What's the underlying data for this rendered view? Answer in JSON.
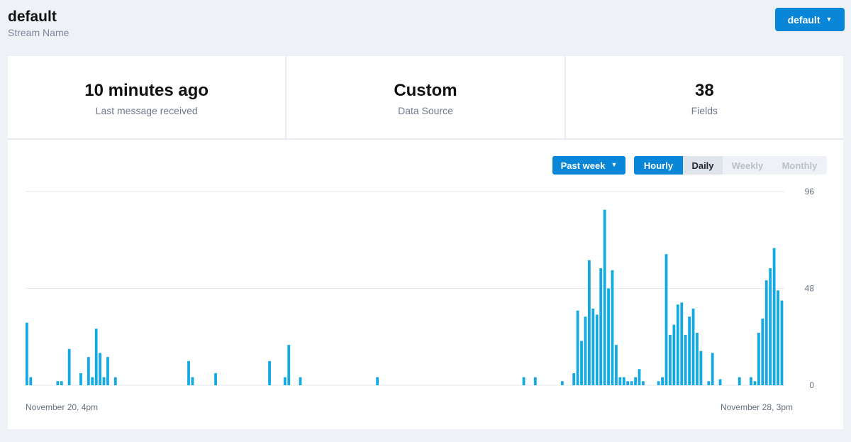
{
  "stream": {
    "title": "default",
    "subtitle": "Stream Name",
    "selector_label": "default"
  },
  "stats": [
    {
      "value": "10 minutes ago",
      "label": "Last message received"
    },
    {
      "value": "Custom",
      "label": "Data Source"
    },
    {
      "value": "38",
      "label": "Fields"
    }
  ],
  "controls": {
    "range_label": "Past week",
    "granularity": [
      "Hourly",
      "Daily",
      "Weekly",
      "Monthly"
    ],
    "granularity_active": "Hourly"
  },
  "icons": {
    "dropdown": "chevron-down-icon"
  },
  "colors": {
    "accent": "#0a86d8",
    "bar": "#13aae3"
  },
  "chart_data": {
    "type": "bar",
    "x_start_label": "November 20, 4pm",
    "x_end_label": "November 28, 3pm",
    "y_ticks": [
      0,
      48,
      96
    ],
    "ylim": [
      0,
      96
    ],
    "grid": true,
    "values": [
      31,
      4,
      0,
      0,
      0,
      0,
      0,
      0,
      2,
      2,
      0,
      18,
      0,
      0,
      6,
      0,
      14,
      4,
      28,
      16,
      4,
      14,
      0,
      4,
      0,
      0,
      0,
      0,
      0,
      0,
      0,
      0,
      0,
      0,
      0,
      0,
      0,
      0,
      0,
      0,
      0,
      0,
      12,
      4,
      0,
      0,
      0,
      0,
      0,
      6,
      0,
      0,
      0,
      0,
      0,
      0,
      0,
      0,
      0,
      0,
      0,
      0,
      0,
      12,
      0,
      0,
      0,
      4,
      20,
      0,
      0,
      4,
      0,
      0,
      0,
      0,
      0,
      0,
      0,
      0,
      0,
      0,
      0,
      0,
      0,
      0,
      0,
      0,
      0,
      0,
      0,
      4,
      0,
      0,
      0,
      0,
      0,
      0,
      0,
      0,
      0,
      0,
      0,
      0,
      0,
      0,
      0,
      0,
      0,
      0,
      0,
      0,
      0,
      0,
      0,
      0,
      0,
      0,
      0,
      0,
      0,
      0,
      0,
      0,
      0,
      0,
      0,
      0,
      0,
      4,
      0,
      0,
      4,
      0,
      0,
      0,
      0,
      0,
      0,
      2,
      0,
      0,
      6,
      37,
      22,
      34,
      62,
      38,
      35,
      58,
      87,
      48,
      57,
      20,
      4,
      4,
      2,
      2,
      4,
      8,
      2,
      0,
      0,
      0,
      2,
      4,
      65,
      25,
      30,
      40,
      41,
      25,
      34,
      38,
      26,
      17,
      0,
      2,
      16,
      0,
      3,
      0,
      0,
      0,
      0,
      4,
      0,
      0,
      4,
      2,
      26,
      33,
      52,
      58,
      68,
      47,
      42
    ]
  }
}
